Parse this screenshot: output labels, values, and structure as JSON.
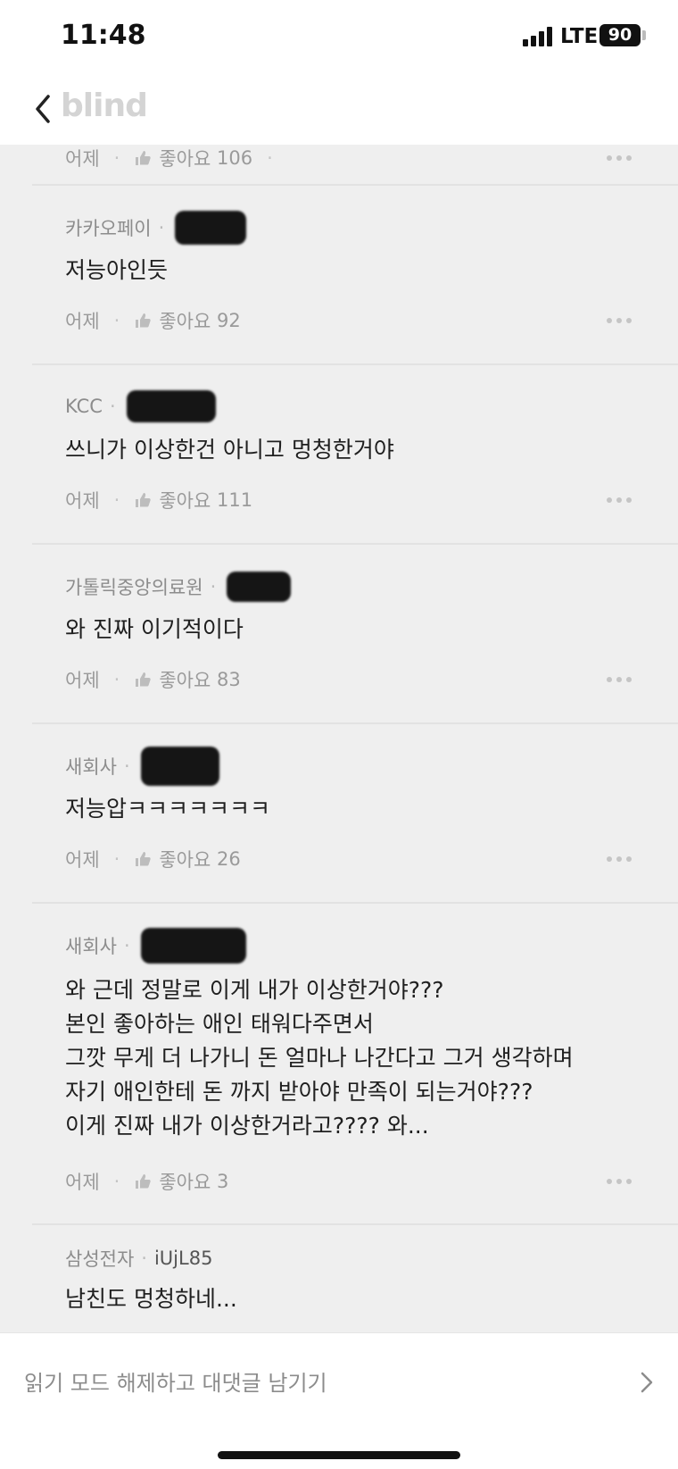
{
  "status": {
    "time": "11:48",
    "network": "LTE",
    "battery": "90"
  },
  "nav": {
    "brand": "blind"
  },
  "comments": [
    {
      "company": "",
      "comment": "",
      "time": "어제",
      "like_label": "좋아요",
      "like_count": "106"
    },
    {
      "company": "카카오페이",
      "comment": "저능아인듯",
      "time": "어제",
      "like_label": "좋아요",
      "like_count": "92"
    },
    {
      "company": "KCC",
      "comment": "쓰니가 이상한건 아니고 멍청한거야",
      "time": "어제",
      "like_label": "좋아요",
      "like_count": "111"
    },
    {
      "company": "가톨릭중앙의료원",
      "comment": "와 진짜 이기적이다",
      "time": "어제",
      "like_label": "좋아요",
      "like_count": "83"
    },
    {
      "company": "새회사",
      "comment": "저능압ㅋㅋㅋㅋㅋㅋㅋ",
      "time": "어제",
      "like_label": "좋아요",
      "like_count": "26"
    },
    {
      "company": "새회사",
      "comment": [
        "와 근데 정말로 이게 내가 이상한거야???",
        "본인 좋아하는 애인 태워다주면서",
        "그깟 무게 더 나가니 돈 얼마나 나간다고 그거 생각하며",
        "자기 애인한테 돈 까지 받아야  만족이 되는거야???",
        "이게 진짜 내가 이상한거라고???? 와..."
      ],
      "time": "어제",
      "like_label": "좋아요",
      "like_count": "3"
    },
    {
      "company": "삼성전자",
      "nickname": "iUjL85",
      "comment": "남친도 멍청하네..."
    }
  ],
  "bottom": {
    "reply_prompt": "읽기 모드 해제하고 대댓글 남기기"
  },
  "colors": {
    "feed_bg": "#efefef",
    "muted_text": "#8c8c8c",
    "brand_text": "#d4d4d4"
  }
}
